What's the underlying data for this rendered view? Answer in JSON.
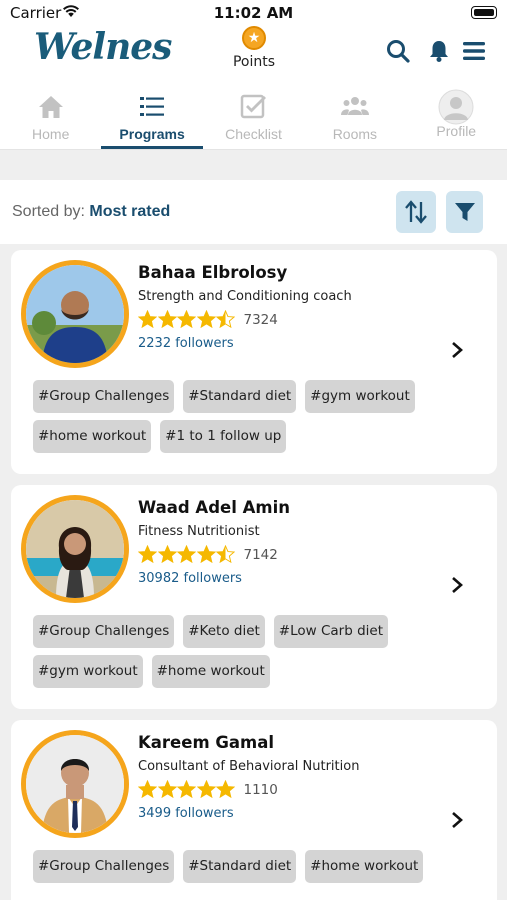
{
  "status_bar": {
    "carrier": "Carrier",
    "time": "11:02 AM"
  },
  "header": {
    "logo": "Welnes",
    "points_label": "Points"
  },
  "tabs": [
    {
      "label": "Home",
      "icon": "home-icon",
      "active": false
    },
    {
      "label": "Programs",
      "icon": "list-icon",
      "active": true
    },
    {
      "label": "Checklist",
      "icon": "checklist-icon",
      "active": false
    },
    {
      "label": "Rooms",
      "icon": "people-icon",
      "active": false
    },
    {
      "label": "Profile",
      "icon": "profile-icon",
      "active": false
    }
  ],
  "sort": {
    "prefix": "Sorted by:",
    "value": "Most rated"
  },
  "coaches": [
    {
      "name": "Bahaa Elbrolosy",
      "role": "Strength and Conditioning coach",
      "rating": 4.5,
      "rating_count": "7324",
      "followers": "2232 followers",
      "tags": [
        "#Group Challenges",
        "#Standard diet",
        "#gym workout",
        "#home workout",
        "#1 to 1 follow up"
      ]
    },
    {
      "name": "Waad Adel Amin",
      "role": "Fitness Nutritionist",
      "rating": 4.5,
      "rating_count": "7142",
      "followers": "30982 followers",
      "tags": [
        "#Group Challenges",
        "#Keto diet",
        "#Low Carb diet",
        "#gym workout",
        "#home workout"
      ]
    },
    {
      "name": "Kareem Gamal",
      "role": "Consultant of Behavioral Nutrition",
      "rating": 5,
      "rating_count": "1110",
      "followers": "3499 followers",
      "tags": [
        "#Group Challenges",
        "#Standard diet",
        "#home workout"
      ]
    }
  ],
  "colors": {
    "brand": "#1a4d6e",
    "star": "#f5b800",
    "ring": "#f5a51c",
    "chip": "#d4d4d4"
  }
}
